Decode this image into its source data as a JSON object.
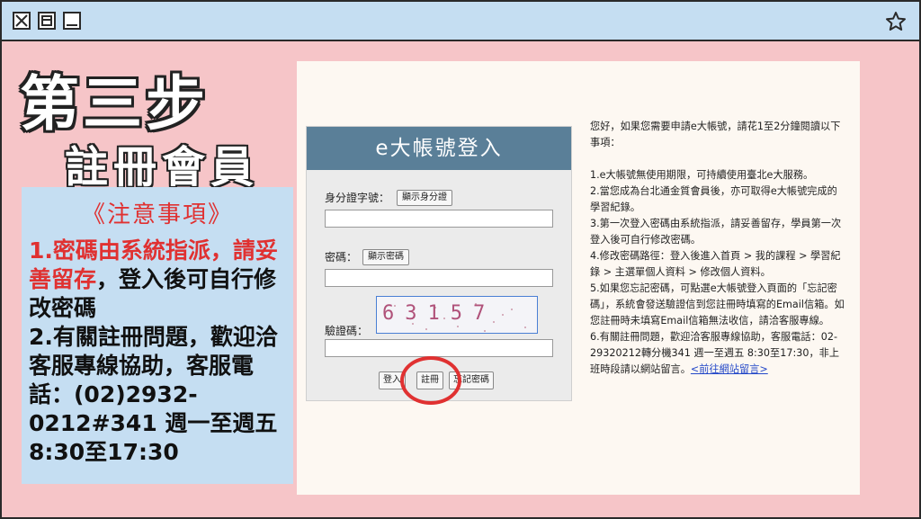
{
  "slide": {
    "step_title": "第三步",
    "step_subtitle": "註冊會員"
  },
  "notice": {
    "heading": "《注意事項》",
    "item1_red": "1.密碼由系統指派，請妥善留存",
    "item1_rest": "，登入後可自行修改密碼",
    "item2": "2.有關註冊問題，歡迎洽客服專線協助，客服電話：(02)2932-0212#341 週一至週五8:30至17:30"
  },
  "login": {
    "title": "e大帳號登入",
    "id_label": "身分證字號：",
    "show_id_button": "顯示身分證",
    "password_label": "密碼：",
    "show_password_button": "顯示密碼",
    "captcha_label": "驗證碼：",
    "captcha_value": "63157",
    "login_button": "登入",
    "register_button": "註冊",
    "forgot_button": "忘記密碼"
  },
  "info": {
    "intro": "您好，如果您需要申請e大帳號，請花1至2分鐘閱讀以下事項：",
    "line1": "1.e大帳號無使用期限，可持續使用臺北e大服務。",
    "line2": "2.當您成為台北通金質會員後，亦可取得e大帳號完成的學習紀錄。",
    "line3": "3.第一次登入密碼由系統指派，請妥善留存，學員第一次登入後可自行修改密碼。",
    "line4": "4.修改密碼路徑：登入後進入首頁 > 我的課程 > 學習紀錄 > 主選單個人資料 > 修改個人資料。",
    "line5": "5.如果您忘記密碼，可點選e大帳號登入頁面的「忘記密碼」，系統會發送驗證信到您註冊時填寫的Email信箱。如您註冊時未填寫Email信箱無法收信，請洽客服專線。",
    "line6": "6.有關註冊問題，歡迎洽客服專線協助，客服電話：02-29320212轉分機341 週一至週五 8:30至17:30，非上班時段請以網站留言。",
    "link": "<前往網站留言>"
  },
  "colors": {
    "background": "#f6c5c8",
    "titlebar": "#c5def2",
    "accent_red": "#e03131",
    "login_header": "#5a7f98"
  },
  "icons": {
    "close": "close-icon",
    "restore": "restore-icon",
    "minimize": "minimize-icon",
    "favorite": "star-icon"
  }
}
